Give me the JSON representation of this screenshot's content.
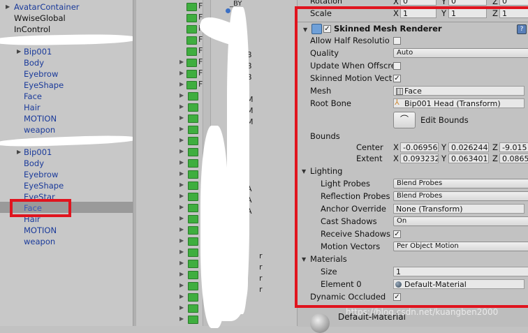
{
  "hierarchy": {
    "top_items": [
      "AvatarContainer",
      "WwiseGlobal",
      "InControl"
    ],
    "group1": [
      "Bip001",
      "Body",
      "Eyebrow",
      "EyeShape",
      "Face",
      "Hair",
      "MOTION",
      "weapon"
    ],
    "group2": [
      "Bip001",
      "Body",
      "Eyebrow",
      "EyeShape",
      "EyeStar",
      "Face",
      "Hair",
      "MOTION",
      "weapon"
    ]
  },
  "project": {
    "file_prefix": "F",
    "partial_labels": [
      "_BY",
      "B",
      "B",
      "B",
      "M",
      "M",
      "M",
      "A",
      "A",
      "A",
      "r",
      "r",
      "r",
      "r"
    ]
  },
  "inspector": {
    "rotation_label": "Rotation",
    "rotation": {
      "x": "0",
      "y": "0",
      "z": "0"
    },
    "scale_label": "Scale",
    "scale": {
      "x": "1",
      "y": "1",
      "z": "1"
    },
    "axis": {
      "x": "X",
      "y": "Y",
      "z": "Z"
    },
    "component_title": "Skinned Mesh Renderer",
    "allow_half_resolution_label": "Allow Half Resolutio",
    "quality_label": "Quality",
    "quality_value": "Auto",
    "update_when_offscreen_label": "Update When Offscre",
    "skinned_motion_vectors_label": "Skinned Motion Vect",
    "mesh_label": "Mesh",
    "mesh_value": "Face",
    "root_bone_label": "Root Bone",
    "root_bone_value": "Bip001 Head (Transform)",
    "edit_bounds_label": "Edit Bounds",
    "bounds_label": "Bounds",
    "center_label": "Center",
    "center": {
      "x": "-0.06956",
      "y": "0.026244",
      "z": "-9.015"
    },
    "extent_label": "Extent",
    "extent": {
      "x": "0.093232",
      "y": "0.063401",
      "z": "0.0865"
    },
    "lighting_label": "Lighting",
    "light_probes_label": "Light Probes",
    "light_probes_value": "Blend Probes",
    "reflection_probes_label": "Reflection Probes",
    "reflection_probes_value": "Blend Probes",
    "anchor_override_label": "Anchor Override",
    "anchor_override_value": "None (Transform)",
    "cast_shadows_label": "Cast Shadows",
    "cast_shadows_value": "On",
    "receive_shadows_label": "Receive Shadows",
    "motion_vectors_label": "Motion Vectors",
    "motion_vectors_value": "Per Object Motion",
    "materials_label": "Materials",
    "size_label": "Size",
    "size_value": "1",
    "element0_label": "Element 0",
    "element0_value": "Default-Material",
    "dynamic_occluded_label": "Dynamic Occluded",
    "bottom_material_label": "Default-Material",
    "checkmark": "✓"
  },
  "watermark": "https://blog.csdn.net/kuangben2000",
  "colors": {
    "highlight_red": "#e0141e",
    "hierarchy_blue": "#1a3a9a",
    "folder_green": "#3fae3f"
  }
}
